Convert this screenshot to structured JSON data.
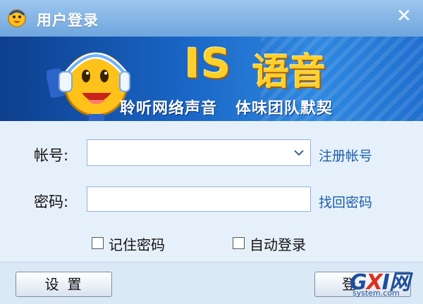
{
  "window": {
    "title": "用户登录",
    "close_glyph": "✕"
  },
  "banner": {
    "brand_prefix": "IS",
    "brand_name": "语音",
    "slogan_left": "聆听网络声音",
    "slogan_right": "体味团队默契"
  },
  "form": {
    "account_label": "帐号:",
    "account_value": "",
    "password_label": "密码:",
    "password_value": "",
    "register_link": "注册帐号",
    "recover_link": "找回密码",
    "remember_password_label": "记住密码",
    "remember_password_checked": false,
    "auto_login_label": "自动登录",
    "auto_login_checked": false
  },
  "buttons": {
    "settings": "设置",
    "login": "登"
  },
  "watermark": {
    "logo_g": "G",
    "logo_x": "X",
    "logo_i": "I",
    "logo_cn": "网",
    "site": "system.com"
  },
  "colors": {
    "title_bar": "#6fa6dd",
    "banner_dark": "#0d3f8e",
    "brand_yellow": "#ffd02a",
    "link_blue": "#1c5ea8"
  },
  "icons": [
    "app-face-icon",
    "close-icon",
    "chevron-down-icon",
    "mascot-headset-icon"
  ]
}
